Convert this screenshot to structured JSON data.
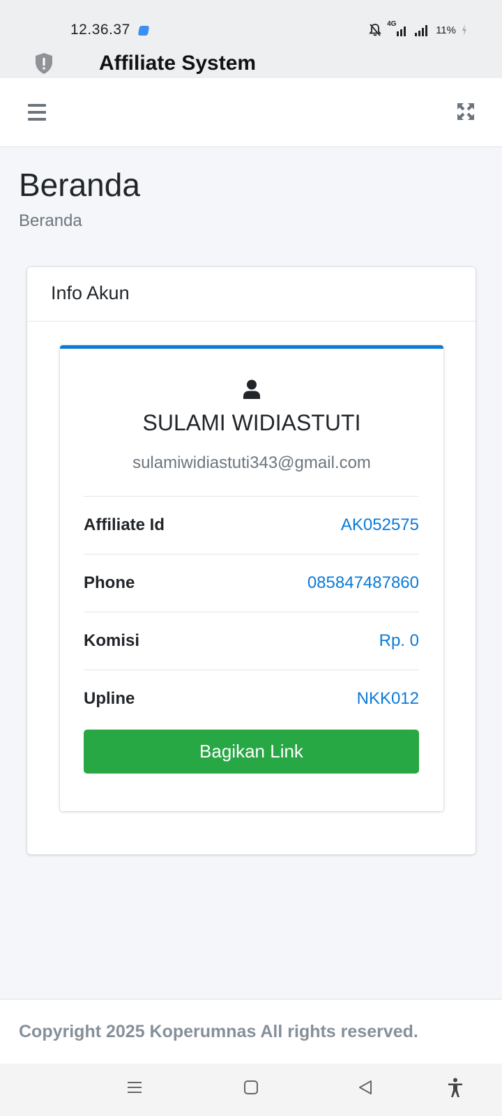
{
  "status_bar": {
    "time": "12.36.37",
    "network": "4G",
    "battery": "11%"
  },
  "app": {
    "title": "Affiliate System"
  },
  "navbar": {
    "menu_icon": "hamburger-icon",
    "fullscreen_icon": "expand-icon"
  },
  "header": {
    "title": "Beranda",
    "breadcrumb": "Beranda"
  },
  "card": {
    "title": "Info Akun"
  },
  "profile": {
    "name": "SULAMI WIDIASTUTI",
    "email": "sulamiwidiastuti343@gmail.com",
    "rows": [
      {
        "label": "Affiliate Id",
        "value": "AK052575"
      },
      {
        "label": "Phone",
        "value": "085847487860"
      },
      {
        "label": "Komisi",
        "value": "Rp. 0"
      },
      {
        "label": "Upline",
        "value": "NKK012"
      }
    ],
    "share_label": "Bagikan Link"
  },
  "footer": {
    "text": "Copyright 2025 Koperumnas All rights reserved."
  },
  "colors": {
    "accent": "#0a7ad8",
    "success": "#28a745",
    "text": "#212529",
    "muted": "#6c757d",
    "background": "#f4f6f9"
  }
}
